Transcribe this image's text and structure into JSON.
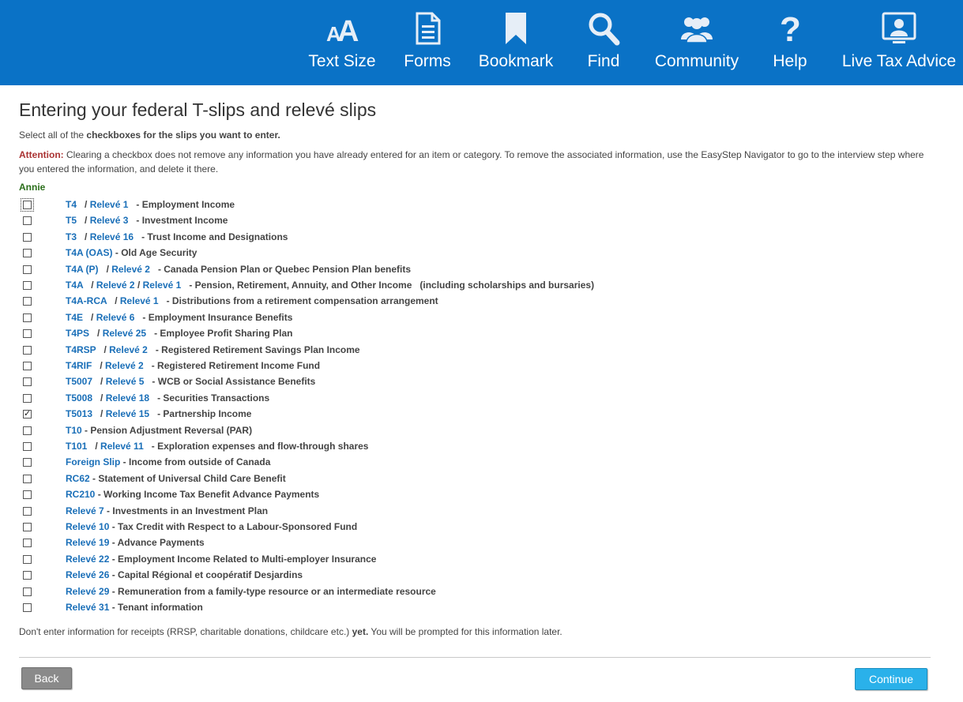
{
  "toolbar": {
    "items": [
      {
        "label": "Text Size",
        "icon": "text-size-icon"
      },
      {
        "label": "Forms",
        "icon": "forms-icon"
      },
      {
        "label": "Bookmark",
        "icon": "bookmark-icon"
      },
      {
        "label": "Find",
        "icon": "search-icon"
      },
      {
        "label": "Community",
        "icon": "community-icon"
      },
      {
        "label": "Help",
        "icon": "help-icon"
      },
      {
        "label": "Live Tax Advice",
        "icon": "live-tax-advice-icon"
      }
    ],
    "background": "#0a72c6"
  },
  "page": {
    "title": "Entering your federal T-slips and relevé slips",
    "instruction_prefix": "Select all of the ",
    "instruction_bold": "checkboxes for the slips you want to enter.",
    "attention_label": "Attention:",
    "attention_text": " Clearing a checkbox does not remove any information you have already entered for an item or category. To remove the associated information, use the EasyStep Navigator to go to the interview step where you entered the information, and delete it there.",
    "person": "Annie",
    "footnote_prefix": "Don't enter information for receipts (RRSP, charitable donations, childcare etc.) ",
    "footnote_bold": "yet.",
    "footnote_suffix": " You will be prompted for this information later."
  },
  "slips": [
    {
      "links": [
        "T4",
        "Relevé 1"
      ],
      "desc": "Employment Income",
      "checked": false,
      "focused": true
    },
    {
      "links": [
        "T5",
        "Relevé 3"
      ],
      "desc": "Investment Income",
      "checked": false
    },
    {
      "links": [
        "T3",
        "Relevé 16"
      ],
      "desc": "Trust Income and Designations",
      "checked": false
    },
    {
      "links": [
        "T4A (OAS)"
      ],
      "desc": "Old Age Security",
      "checked": false
    },
    {
      "links": [
        "T4A (P)",
        "Relevé 2"
      ],
      "desc": "Canada Pension Plan or Quebec Pension Plan benefits",
      "checked": false
    },
    {
      "links": [
        "T4A",
        "Relevé 2",
        "Relevé 1"
      ],
      "desc": "Pension, Retirement, Annuity, and Other Income   (including scholarships and bursaries)",
      "checked": false
    },
    {
      "links": [
        "T4A-RCA",
        "Relevé 1"
      ],
      "desc": "Distributions from a retirement compensation arrangement",
      "checked": false
    },
    {
      "links": [
        "T4E",
        "Relevé 6"
      ],
      "desc": "Employment Insurance Benefits",
      "checked": false
    },
    {
      "links": [
        "T4PS",
        "Relevé 25"
      ],
      "desc": "Employee Profit Sharing Plan",
      "checked": false
    },
    {
      "links": [
        "T4RSP",
        "Relevé 2"
      ],
      "desc": "Registered Retirement Savings Plan Income",
      "checked": false
    },
    {
      "links": [
        "T4RIF",
        "Relevé 2"
      ],
      "desc": "Registered Retirement Income Fund",
      "checked": false
    },
    {
      "links": [
        "T5007",
        "Relevé 5"
      ],
      "desc": "WCB or Social Assistance Benefits",
      "checked": false
    },
    {
      "links": [
        "T5008",
        "Relevé 18"
      ],
      "desc": "Securities Transactions",
      "checked": false
    },
    {
      "links": [
        "T5013",
        "Relevé 15"
      ],
      "desc": "Partnership Income",
      "checked": true
    },
    {
      "links": [
        "T10"
      ],
      "desc": "Pension Adjustment Reversal (PAR)",
      "checked": false
    },
    {
      "links": [
        "T101",
        "Relevé 11"
      ],
      "desc": "Exploration expenses and flow-through shares",
      "checked": false
    },
    {
      "links": [
        "Foreign Slip"
      ],
      "desc": "Income from outside of Canada",
      "checked": false
    },
    {
      "links": [
        "RC62"
      ],
      "desc": "Statement of Universal Child Care Benefit",
      "checked": false
    },
    {
      "links": [
        "RC210"
      ],
      "desc": "Working Income Tax Benefit Advance Payments",
      "checked": false
    },
    {
      "links": [
        "Relevé 7"
      ],
      "desc": "Investments in an Investment Plan",
      "checked": false
    },
    {
      "links": [
        "Relevé 10"
      ],
      "desc": "Tax Credit with Respect to a Labour-Sponsored Fund",
      "checked": false
    },
    {
      "links": [
        "Relevé 19"
      ],
      "desc": "Advance Payments",
      "checked": false
    },
    {
      "links": [
        "Relevé 22"
      ],
      "desc": "Employment Income Related to Multi-employer Insurance",
      "checked": false
    },
    {
      "links": [
        "Relevé 26"
      ],
      "desc": "Capital Régional et coopératif Desjardins",
      "checked": false
    },
    {
      "links": [
        "Relevé 29"
      ],
      "desc": "Remuneration from a family-type resource or an intermediate resource",
      "checked": false
    },
    {
      "links": [
        "Relevé 31"
      ],
      "desc": "Tenant information",
      "checked": false
    }
  ],
  "buttons": {
    "back": "Back",
    "continue": "Continue"
  },
  "colors": {
    "link": "#1a6fb8",
    "attention": "#a33",
    "person": "#2a6e1a",
    "continue_bg": "#2ab1ea",
    "back_bg": "#8a8a8a"
  }
}
